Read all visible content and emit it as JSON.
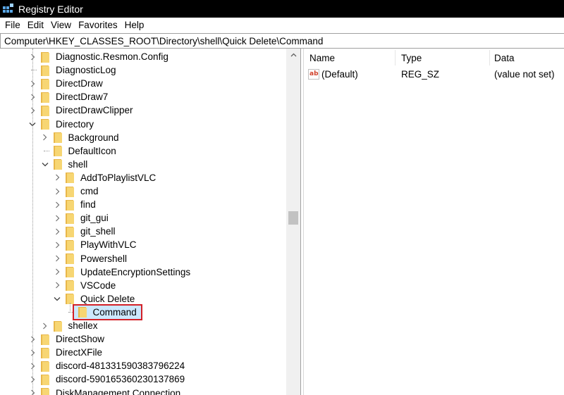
{
  "window": {
    "title": "Registry Editor",
    "icon": "registry-editor-icon"
  },
  "menu": {
    "items": [
      "File",
      "Edit",
      "View",
      "Favorites",
      "Help"
    ]
  },
  "address": {
    "path": "Computer\\HKEY_CLASSES_ROOT\\Directory\\shell\\Quick Delete\\Command"
  },
  "tree": {
    "items": [
      {
        "label": "Diagnostic.Resmon.Config",
        "level": 1,
        "expander": "collapsed"
      },
      {
        "label": "DiagnosticLog",
        "level": 1,
        "expander": "none"
      },
      {
        "label": "DirectDraw",
        "level": 1,
        "expander": "collapsed"
      },
      {
        "label": "DirectDraw7",
        "level": 1,
        "expander": "collapsed"
      },
      {
        "label": "DirectDrawClipper",
        "level": 1,
        "expander": "collapsed"
      },
      {
        "label": "Directory",
        "level": 1,
        "expander": "expanded"
      },
      {
        "label": "Background",
        "level": 2,
        "expander": "collapsed"
      },
      {
        "label": "DefaultIcon",
        "level": 2,
        "expander": "none"
      },
      {
        "label": "shell",
        "level": 2,
        "expander": "expanded"
      },
      {
        "label": "AddToPlaylistVLC",
        "level": 3,
        "expander": "collapsed"
      },
      {
        "label": "cmd",
        "level": 3,
        "expander": "collapsed"
      },
      {
        "label": "find",
        "level": 3,
        "expander": "collapsed"
      },
      {
        "label": "git_gui",
        "level": 3,
        "expander": "collapsed"
      },
      {
        "label": "git_shell",
        "level": 3,
        "expander": "collapsed"
      },
      {
        "label": "PlayWithVLC",
        "level": 3,
        "expander": "collapsed"
      },
      {
        "label": "Powershell",
        "level": 3,
        "expander": "collapsed"
      },
      {
        "label": "UpdateEncryptionSettings",
        "level": 3,
        "expander": "collapsed"
      },
      {
        "label": "VSCode",
        "level": 3,
        "expander": "collapsed"
      },
      {
        "label": "Quick Delete",
        "level": 3,
        "expander": "expanded"
      },
      {
        "label": "Command",
        "level": 4,
        "expander": "none",
        "selected": true
      },
      {
        "label": "shellex",
        "level": 2,
        "expander": "collapsed"
      },
      {
        "label": "DirectShow",
        "level": 1,
        "expander": "collapsed"
      },
      {
        "label": "DirectXFile",
        "level": 1,
        "expander": "collapsed"
      },
      {
        "label": "discord-481331590383796224",
        "level": 1,
        "expander": "collapsed"
      },
      {
        "label": "discord-590165360230137869",
        "level": 1,
        "expander": "collapsed"
      },
      {
        "label": "DiskManagement.Connection",
        "level": 1,
        "expander": "collapsed"
      }
    ]
  },
  "values": {
    "columns": [
      "Name",
      "Type",
      "Data"
    ],
    "rows": [
      {
        "name": "(Default)",
        "type": "REG_SZ",
        "data": "(value not set)",
        "icon": "string-value-icon"
      }
    ]
  },
  "colors": {
    "titlebar": "#000000",
    "selection": "#cce8ff",
    "highlight_box": "#d32027",
    "folder": "#f7d673"
  }
}
